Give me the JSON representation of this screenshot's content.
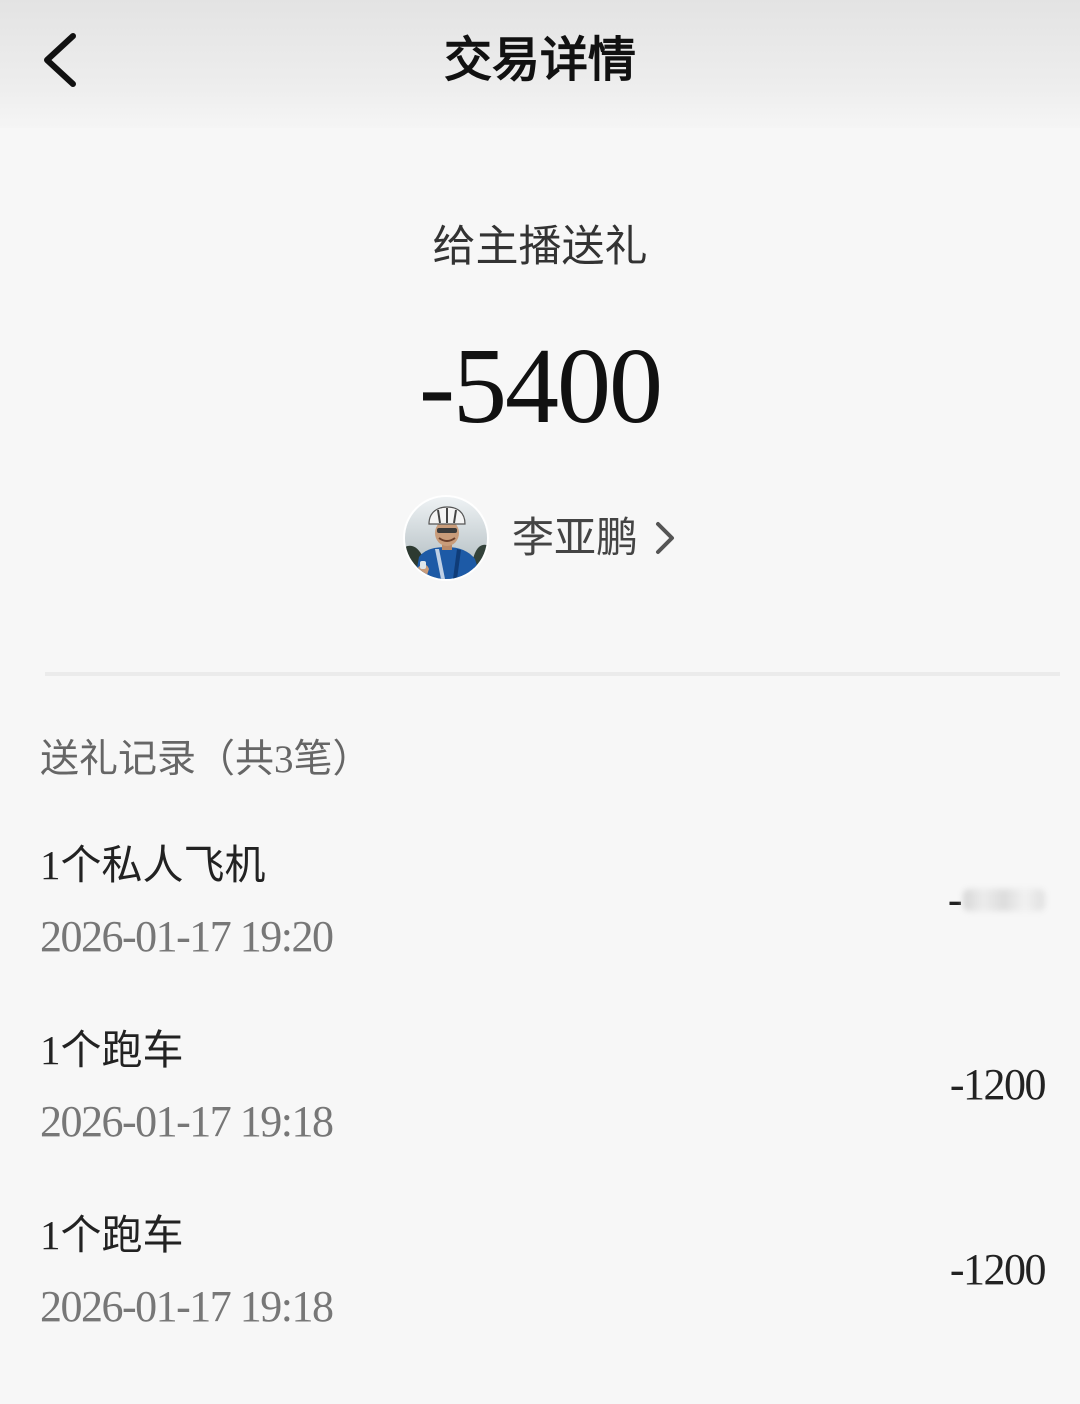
{
  "header": {
    "title": "交易详情",
    "back_icon": "chevron-left-icon"
  },
  "transaction": {
    "type_label": "给主播送礼",
    "amount": "-5400",
    "recipient_name": "李亚鹏",
    "recipient_icon": "chevron-right-icon"
  },
  "records": {
    "title": "送礼记录（共3笔）",
    "items": [
      {
        "name": "1个私人飞机",
        "time": "2026-01-17 19:20",
        "amount": "-"
      },
      {
        "name": "1个跑车",
        "time": "2026-01-17 19:18",
        "amount": "-1200"
      },
      {
        "name": "1个跑车",
        "time": "2026-01-17 19:18",
        "amount": "-1200"
      }
    ]
  },
  "colors": {
    "background": "#f7f7f7",
    "primary_text": "#111111",
    "secondary_text": "#777777",
    "divider": "#ebebeb"
  }
}
